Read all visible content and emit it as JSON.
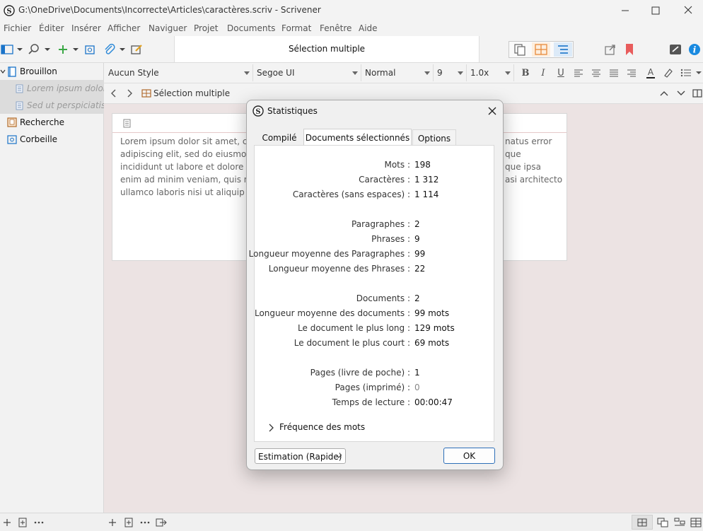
{
  "window": {
    "title": "G:\\OneDrive\\Documents\\Incorrecte\\Articles\\caractères.scriv - Scrivener"
  },
  "menu": [
    "Fichier",
    "Éditer",
    "Insérer",
    "Afficher",
    "Naviguer",
    "Projet",
    "Documents",
    "Format",
    "Fenêtre",
    "Aide"
  ],
  "toolbar": {
    "document_title": "Sélection multiple"
  },
  "binder": {
    "items": [
      {
        "label": "Brouillon"
      },
      {
        "label": "Lorem ipsum dolor..."
      },
      {
        "label": "Sed ut perspiciatis ..."
      },
      {
        "label": "Recherche"
      },
      {
        "label": "Corbeille"
      }
    ]
  },
  "format_bar": {
    "style": "Aucun Style",
    "font": "Segoe UI",
    "weight": "Normal",
    "size": "9",
    "line_spacing": "1.0x"
  },
  "header_bar": {
    "title": "Sélection multiple"
  },
  "editor": {
    "lines": [
      "Lorem ipsum dolor sit amet, co",
      "adipiscing elit, sed do eiusmod",
      "incididunt ut labore et dolore m",
      "enim ad minim veniam, quis no",
      "ullamco laboris nisi ut aliquip"
    ],
    "lines_right": [
      "natus error",
      "que",
      "que ipsa",
      "asi architecto"
    ]
  },
  "dialog": {
    "title": "Statistiques",
    "tabs": [
      "Compilé",
      "Documents sélectionnés",
      "Options"
    ],
    "active_tab": "Documents sélectionnés",
    "stats": [
      {
        "label": "Mots :",
        "value": "198"
      },
      {
        "label": "Caractères :",
        "value": "1 312"
      },
      {
        "label": "Caractères (sans espaces) :",
        "value": "1 114"
      },
      {
        "label": "Paragraphes :",
        "value": "2"
      },
      {
        "label": "Phrases :",
        "value": "9"
      },
      {
        "label": "Longueur moyenne des Paragraphes :",
        "value": "99"
      },
      {
        "label": "Longueur moyenne des Phrases :",
        "value": "22"
      },
      {
        "label": "Documents :",
        "value": "2"
      },
      {
        "label": "Longueur moyenne des documents :",
        "value": "99 mots"
      },
      {
        "label": "Le document le plus long :",
        "value": "129 mots"
      },
      {
        "label": "Le document le plus court :",
        "value": "69 mots"
      },
      {
        "label": "Pages (livre de poche) :",
        "value": "1"
      },
      {
        "label": "Pages (imprimé) :",
        "value": "0"
      },
      {
        "label": "Temps de lecture :",
        "value": "00:00:47"
      }
    ],
    "frequency_label": "Fréquence des mots",
    "estimation": "Estimation (Rapide)",
    "ok_label": "OK"
  },
  "colors": {
    "accent_blue": "#2d6fb8",
    "bookmark_red": "#e85c5c",
    "toolbar_green": "#3aa845",
    "grid_orange": "#e88a3a"
  }
}
